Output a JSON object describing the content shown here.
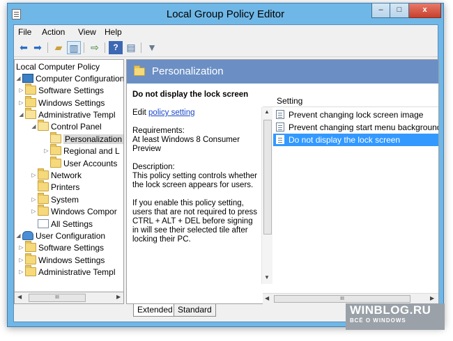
{
  "window": {
    "title": "Local Group Policy Editor",
    "close_glyph": "x",
    "minimize_glyph": "–",
    "maximize_glyph": "□"
  },
  "menu": [
    "File",
    "Action",
    "View",
    "Help"
  ],
  "toolbar": {
    "icons": [
      "back-icon",
      "forward-icon",
      "up-folder-icon",
      "show-hide-tree-icon",
      "export-list-icon",
      "help-icon",
      "view-icon",
      "filter-icon"
    ]
  },
  "tree": {
    "items": [
      {
        "label": "Local Computer Policy",
        "icon": "none",
        "expander": ""
      },
      {
        "label": "Computer Configuration",
        "icon": "computer-icon",
        "expander": "◢"
      },
      {
        "label": "Software Settings",
        "icon": "folder-icon",
        "expander": "▷"
      },
      {
        "label": "Windows Settings",
        "icon": "folder-icon",
        "expander": "▷"
      },
      {
        "label": "Administrative Templ",
        "icon": "folder-icon",
        "expander": "◢"
      },
      {
        "label": "Control Panel",
        "icon": "folder-icon",
        "expander": "◢"
      },
      {
        "label": "Personalization",
        "icon": "folder-icon",
        "expander": ""
      },
      {
        "label": "Regional and L",
        "icon": "folder-icon",
        "expander": "▷"
      },
      {
        "label": "User Accounts",
        "icon": "folder-icon",
        "expander": ""
      },
      {
        "label": "Network",
        "icon": "folder-icon",
        "expander": "▷"
      },
      {
        "label": "Printers",
        "icon": "folder-icon",
        "expander": ""
      },
      {
        "label": "System",
        "icon": "folder-icon",
        "expander": "▷"
      },
      {
        "label": "Windows Compor",
        "icon": "folder-icon",
        "expander": "▷"
      },
      {
        "label": "All Settings",
        "icon": "all-settings-icon",
        "expander": ""
      },
      {
        "label": "User Configuration",
        "icon": "user-icon",
        "expander": "◢"
      },
      {
        "label": "Software Settings",
        "icon": "folder-icon",
        "expander": "▷"
      },
      {
        "label": "Windows Settings",
        "icon": "folder-icon",
        "expander": "▷"
      },
      {
        "label": "Administrative Templ",
        "icon": "folder-icon",
        "expander": "▷"
      }
    ],
    "selected": "Personalization"
  },
  "details": {
    "heading": "Personalization",
    "policy_title": "Do not display the lock screen",
    "edit_prefix": "Edit",
    "edit_link": "policy setting",
    "requirements_label": "Requirements:",
    "requirements_text": "At least Windows 8 Consumer Preview",
    "description_label": "Description:",
    "description_text": "This policy setting controls whether the lock screen appears for users.",
    "description_more": "If you enable this policy setting, users that are not required to press CTRL + ALT + DEL before signing in will see their selected tile after locking their PC."
  },
  "settings_list": {
    "column": "Setting",
    "rows": [
      "Prevent changing lock screen image",
      "Prevent changing start menu background",
      "Do not display the lock screen"
    ],
    "selected_index": 2
  },
  "tabs": [
    "Extended",
    "Standard"
  ],
  "active_tab": "Extended",
  "watermark": {
    "line1": "WINBLOG.RU",
    "line2": "ВСЁ О WINDOWS"
  },
  "colors": {
    "titlebar": "#6fb7e6",
    "heading_bg": "#6b8fc4",
    "selection": "#3399ff",
    "link": "#1a46c8"
  }
}
